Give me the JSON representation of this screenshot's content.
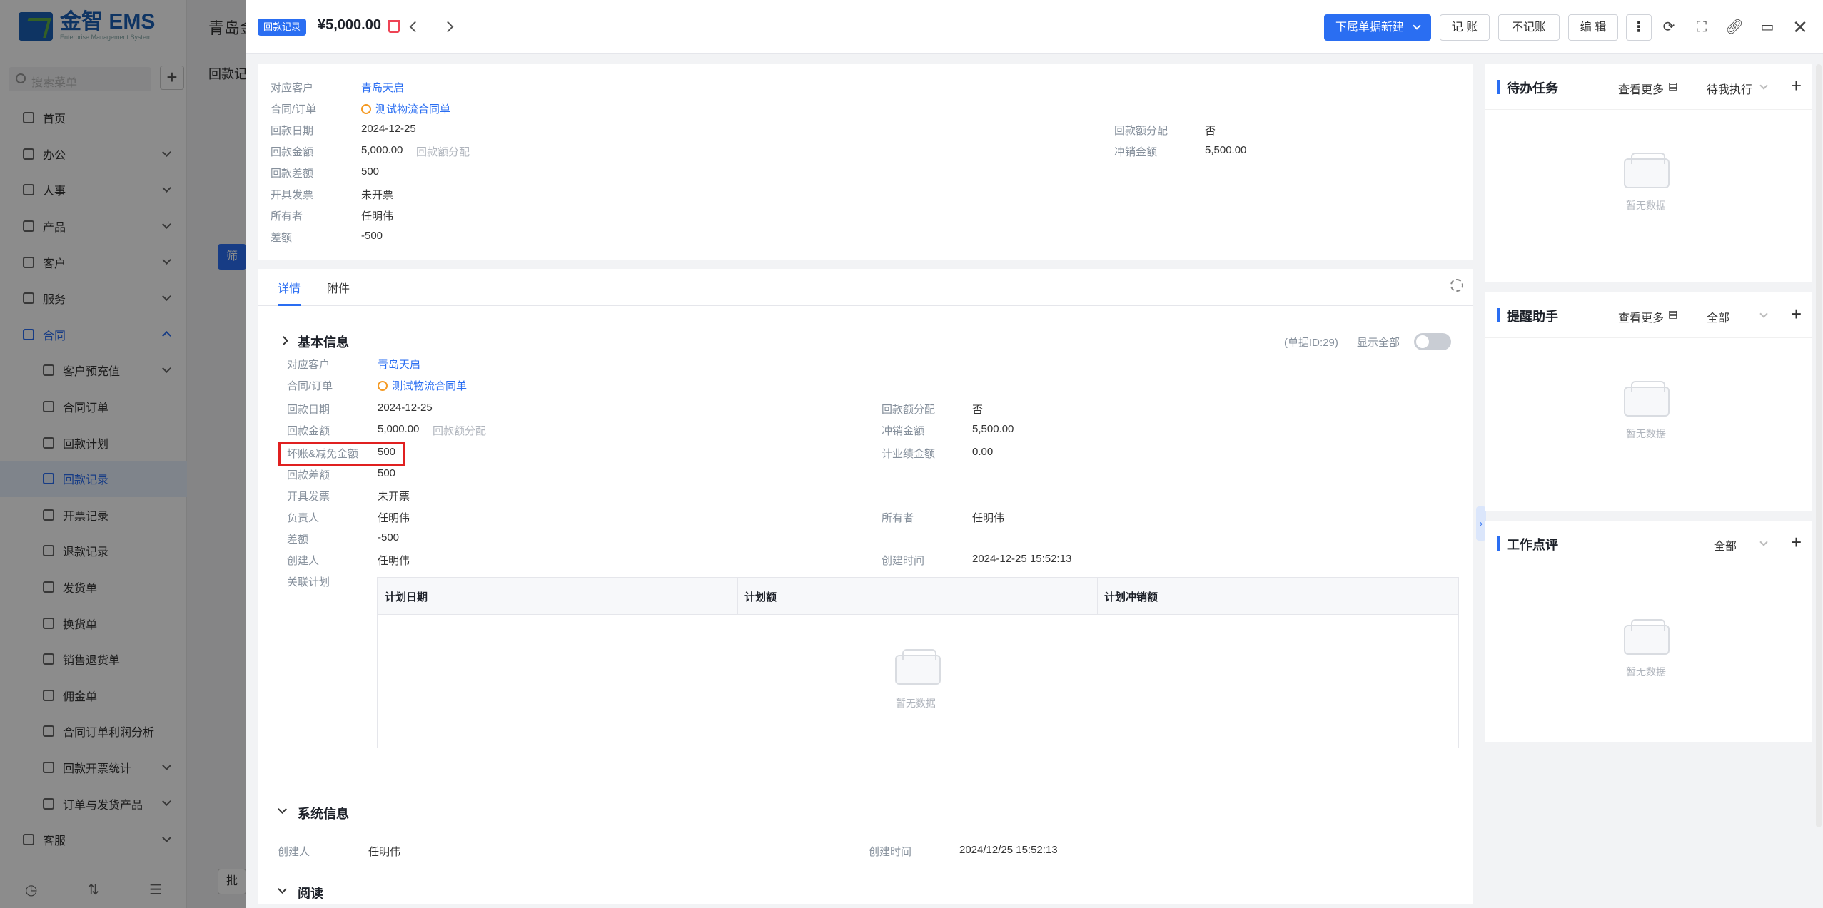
{
  "app": {
    "brand": "金智 EMS",
    "brand_sub": "Enterprise Management System"
  },
  "sidebar": {
    "search_placeholder": "搜索菜单",
    "items": [
      {
        "label": "首页"
      },
      {
        "label": "办公"
      },
      {
        "label": "人事"
      },
      {
        "label": "产品"
      },
      {
        "label": "客户"
      },
      {
        "label": "服务"
      },
      {
        "label": "合同"
      },
      {
        "label": "客户预充值"
      },
      {
        "label": "合同订单"
      },
      {
        "label": "回款计划"
      },
      {
        "label": "回款记录"
      },
      {
        "label": "开票记录"
      },
      {
        "label": "退款记录"
      },
      {
        "label": "发货单"
      },
      {
        "label": "换货单"
      },
      {
        "label": "销售退货单"
      },
      {
        "label": "佣金单"
      },
      {
        "label": "合同订单利润分析"
      },
      {
        "label": "回款开票统计"
      },
      {
        "label": "订单与发货产品"
      },
      {
        "label": "客服"
      }
    ]
  },
  "background": {
    "title": "青岛金",
    "subtitle": "回款记",
    "button_filter": "筛",
    "button_batch": "批"
  },
  "header": {
    "badge": "回款记录",
    "amount": "¥5,000.00",
    "new_sub": "下属单据新建",
    "btn_book": "记 账",
    "btn_nobook": "不记账",
    "btn_edit": "编 辑"
  },
  "summary": {
    "customer_label": "对应客户",
    "customer": "青岛天启",
    "order_label": "合同/订单",
    "order": "测试物流合同单",
    "date_label": "回款日期",
    "date": "2024-12-25",
    "amount_label": "回款金额",
    "amount": "5,000.00",
    "amount_hint": "回款额分配",
    "diff_label": "回款差额",
    "diff": "500",
    "invoice_label": "开具发票",
    "invoice": "未开票",
    "owner_label": "所有者",
    "owner": "任明伟",
    "gap_label": "差额",
    "gap": "-500",
    "alloc_label": "回款额分配",
    "alloc": "否",
    "writeoff_label": "冲销金额",
    "writeoff": "5,500.00"
  },
  "tabs": {
    "details": "详情",
    "attachments": "附件"
  },
  "basic": {
    "title": "基本信息",
    "doc_id": "(单据ID:29)",
    "show_all": "显示全部",
    "customer_label": "对应客户",
    "customer": "青岛天启",
    "order_label": "合同/订单",
    "order": "测试物流合同单",
    "date_label": "回款日期",
    "date": "2024-12-25",
    "amount_label": "回款金额",
    "amount": "5,000.00",
    "amount_hint": "回款额分配",
    "baddebt_label": "坏账&减免金额",
    "baddebt": "500",
    "diff_label": "回款差额",
    "diff": "500",
    "invoice_label": "开具发票",
    "invoice": "未开票",
    "manager_label": "负责人",
    "manager": "任明伟",
    "gap_label": "差额",
    "gap": "-500",
    "creator_label": "创建人",
    "creator": "任明伟",
    "plan_label": "关联计划",
    "alloc_label": "回款额分配",
    "alloc": "否",
    "writeoff_label": "冲销金额",
    "writeoff": "5,500.00",
    "perf_label": "计业绩金额",
    "perf": "0.00",
    "owner_label": "所有者",
    "owner": "任明伟",
    "created_label": "创建时间",
    "created": "2024-12-25 15:52:13",
    "table_headers": [
      "计划日期",
      "计划额",
      "计划冲销额"
    ],
    "empty": "暂无数据"
  },
  "system": {
    "title": "系统信息",
    "creator_label": "创建人",
    "creator": "任明伟",
    "created_label": "创建时间",
    "created": "2024/12/25 15:52:13"
  },
  "read": {
    "title": "阅读"
  },
  "panels": {
    "todo": {
      "title": "待办任务",
      "more": "查看更多",
      "filter": "待我执行",
      "empty": "暂无数据"
    },
    "reminder": {
      "title": "提醒助手",
      "more": "查看更多",
      "filter": "全部",
      "empty": "暂无数据"
    },
    "review": {
      "title": "工作点评",
      "filter": "全部",
      "empty": "暂无数据"
    }
  }
}
